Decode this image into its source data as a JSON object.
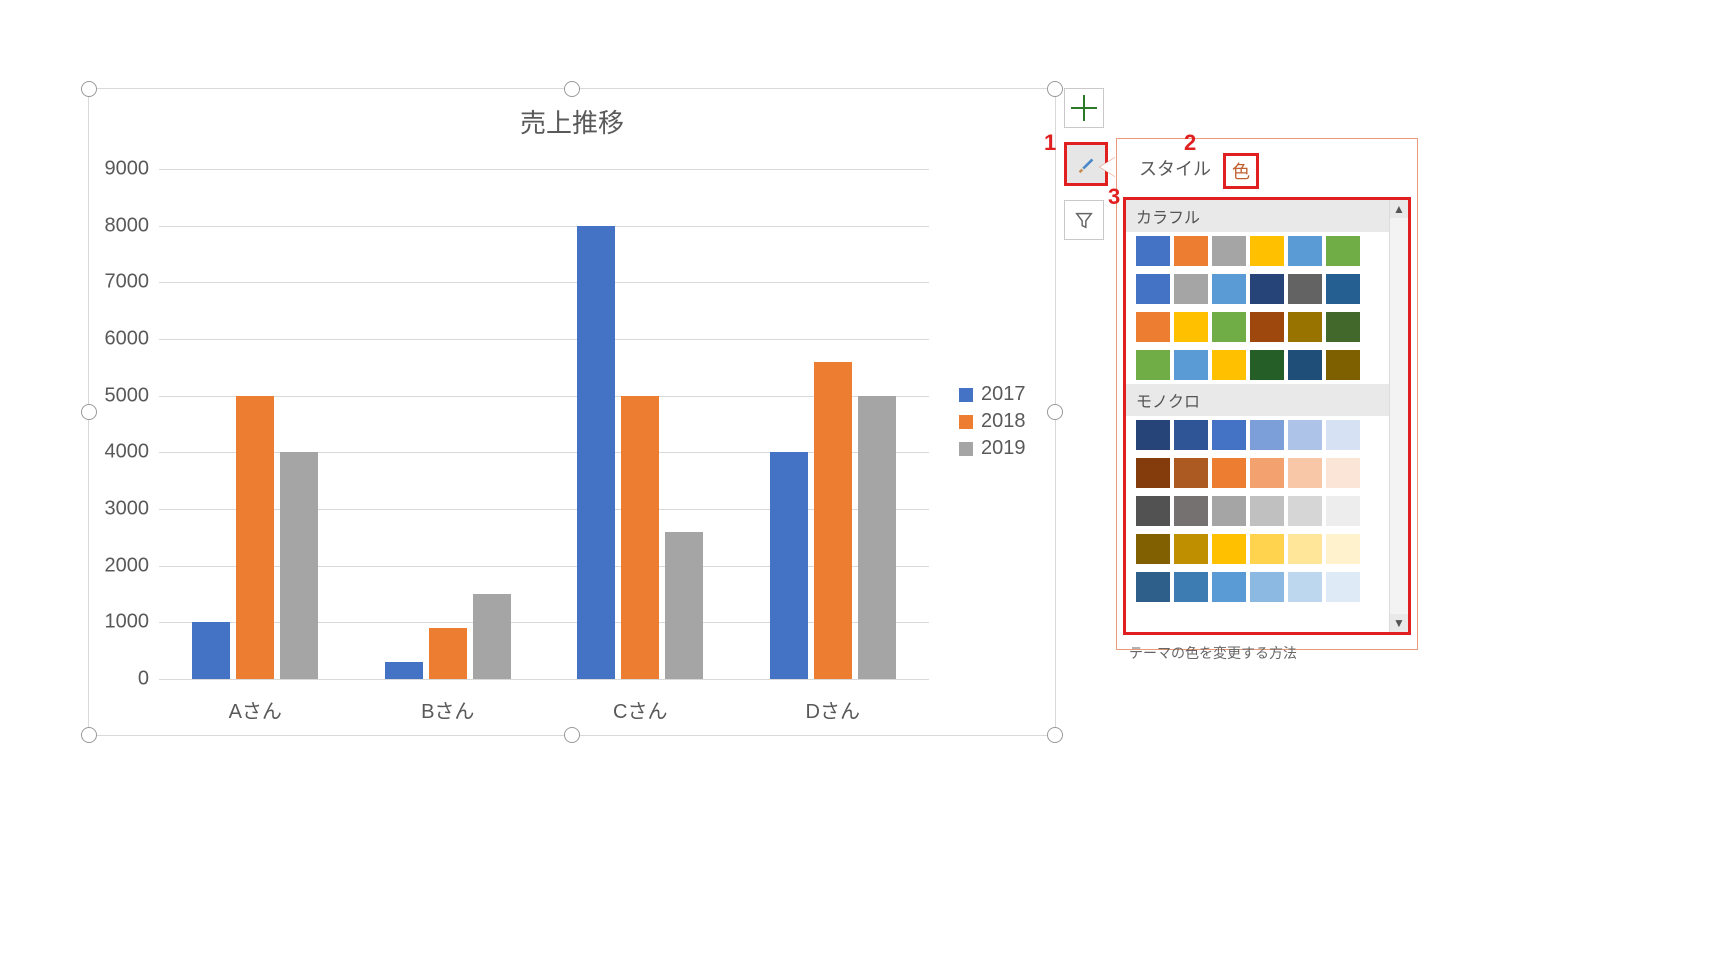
{
  "chart_data": {
    "type": "bar",
    "title": "売上推移",
    "categories": [
      "Aさん",
      "Bさん",
      "Cさん",
      "Dさん"
    ],
    "series": [
      {
        "name": "2017",
        "values": [
          1000,
          300,
          8000,
          4000
        ],
        "color": "#4472c4"
      },
      {
        "name": "2018",
        "values": [
          5000,
          900,
          5000,
          5600
        ],
        "color": "#ed7d31"
      },
      {
        "name": "2019",
        "values": [
          4000,
          1500,
          2600,
          5000
        ],
        "color": "#a5a5a5"
      }
    ],
    "xlabel": "",
    "ylabel": "",
    "ylim": [
      0,
      9000
    ],
    "yticks": [
      0,
      1000,
      2000,
      3000,
      4000,
      5000,
      6000,
      7000,
      8000,
      9000
    ]
  },
  "panel": {
    "tab_style": "スタイル",
    "tab_color": "色",
    "section_colorful": "カラフル",
    "section_mono": "モノクロ",
    "footer_link": "テーマの色を変更する方法",
    "marker1": "1",
    "marker2": "2",
    "marker3": "3",
    "colorful_palettes": [
      [
        "#4472c4",
        "#ed7d31",
        "#a5a5a5",
        "#ffc000",
        "#5b9bd5",
        "#70ad47"
      ],
      [
        "#4472c4",
        "#a5a5a5",
        "#5b9bd5",
        "#264478",
        "#636363",
        "#255e91"
      ],
      [
        "#ed7d31",
        "#ffc000",
        "#70ad47",
        "#9e480e",
        "#997300",
        "#43682b"
      ],
      [
        "#70ad47",
        "#5b9bd5",
        "#ffc000",
        "#255e27",
        "#1f4e79",
        "#7f6000"
      ]
    ],
    "mono_palettes": [
      [
        "#264478",
        "#2f5597",
        "#4472c4",
        "#7c9ed9",
        "#adc3e8",
        "#d7e1f4"
      ],
      [
        "#843c0c",
        "#ad5a22",
        "#ed7d31",
        "#f3a16e",
        "#f7c7a8",
        "#fbe5d6"
      ],
      [
        "#525252",
        "#767171",
        "#a5a5a5",
        "#c0c0c0",
        "#d6d6d6",
        "#ededed"
      ],
      [
        "#806000",
        "#bf8f00",
        "#ffc000",
        "#ffd34d",
        "#ffe699",
        "#fff2cc"
      ],
      [
        "#2e5f8a",
        "#3d7bb3",
        "#5b9bd5",
        "#8cb9e2",
        "#bdd7ee",
        "#deebf7"
      ]
    ]
  }
}
